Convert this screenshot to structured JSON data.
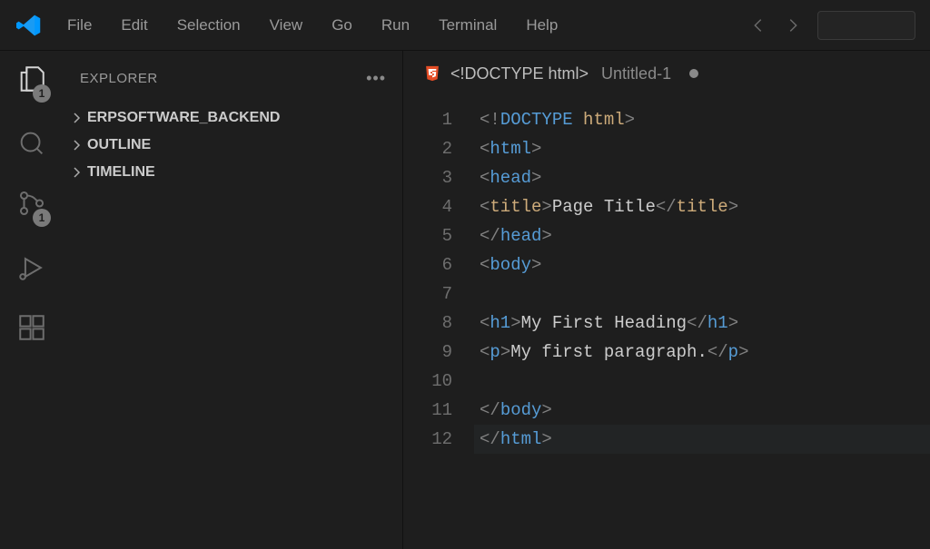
{
  "menu": [
    "File",
    "Edit",
    "Selection",
    "View",
    "Go",
    "Run",
    "Terminal",
    "Help"
  ],
  "sidebar": {
    "title": "EXPLORER",
    "items": [
      "ERPSOFTWARE_BACKEND",
      "OUTLINE",
      "TIMELINE"
    ]
  },
  "activity": {
    "files_badge": "1",
    "scm_badge": "1"
  },
  "tab": {
    "language_indicator": "<!DOCTYPE html>",
    "filename": "Untitled-1"
  },
  "code": {
    "line_numbers": [
      "1",
      "2",
      "3",
      "4",
      "5",
      "6",
      "7",
      "8",
      "9",
      "10",
      "11",
      "12"
    ],
    "lines": [
      [
        [
          "punct",
          "<!"
        ],
        [
          "doctype-kw",
          "DOCTYPE"
        ],
        [
          "text-plain",
          " "
        ],
        [
          "doctype-html",
          "html"
        ],
        [
          "punct",
          ">"
        ]
      ],
      [
        [
          "punct",
          "<"
        ],
        [
          "tag-name",
          "html"
        ],
        [
          "punct",
          ">"
        ]
      ],
      [
        [
          "punct",
          "<"
        ],
        [
          "tag-name",
          "head"
        ],
        [
          "punct",
          ">"
        ]
      ],
      [
        [
          "punct",
          "<"
        ],
        [
          "title-tag",
          "title"
        ],
        [
          "punct",
          ">"
        ],
        [
          "text-plain",
          "Page Title"
        ],
        [
          "punct",
          "</"
        ],
        [
          "title-tag",
          "title"
        ],
        [
          "punct",
          ">"
        ]
      ],
      [
        [
          "punct",
          "</"
        ],
        [
          "tag-name",
          "head"
        ],
        [
          "punct",
          ">"
        ]
      ],
      [
        [
          "punct",
          "<"
        ],
        [
          "tag-name",
          "body"
        ],
        [
          "punct",
          ">"
        ]
      ],
      [],
      [
        [
          "punct",
          "<"
        ],
        [
          "tag-name",
          "h1"
        ],
        [
          "punct",
          ">"
        ],
        [
          "text-plain",
          "My First Heading"
        ],
        [
          "punct",
          "</"
        ],
        [
          "tag-name",
          "h1"
        ],
        [
          "punct",
          ">"
        ]
      ],
      [
        [
          "punct",
          "<"
        ],
        [
          "tag-name",
          "p"
        ],
        [
          "punct",
          ">"
        ],
        [
          "text-plain",
          "My first paragraph."
        ],
        [
          "punct",
          "</"
        ],
        [
          "tag-name",
          "p"
        ],
        [
          "punct",
          ">"
        ]
      ],
      [],
      [
        [
          "punct",
          "</"
        ],
        [
          "tag-name",
          "body"
        ],
        [
          "punct",
          ">"
        ]
      ],
      [
        [
          "punct",
          "</"
        ],
        [
          "tag-name",
          "html"
        ],
        [
          "punct",
          ">"
        ]
      ]
    ],
    "current_line_index": 11
  }
}
